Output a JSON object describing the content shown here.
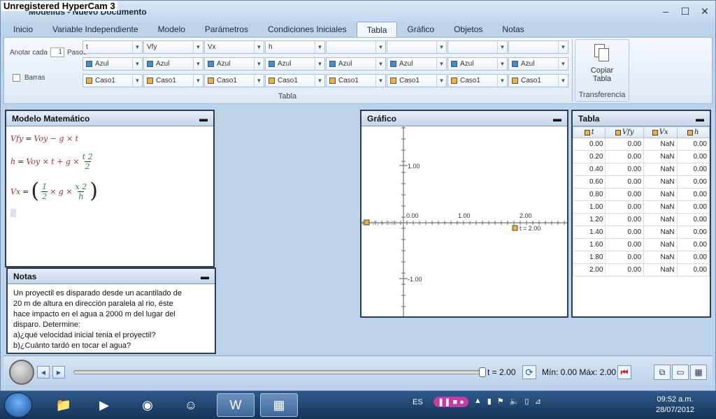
{
  "watermark": "Unregistered HyperCam 3",
  "window": {
    "title": "Modellus - Nuevo Documento"
  },
  "tabs": [
    "Inicio",
    "Variable Independiente",
    "Modelo",
    "Parámetros",
    "Condiciones Iniciales",
    "Tabla",
    "Gráfico",
    "Objetos",
    "Notas"
  ],
  "active_tab": "Tabla",
  "ribbon": {
    "anotar_label": "Anotar cada",
    "anotar_value": "1",
    "pasos_label": "Pasos",
    "barras_label": "Barras",
    "group_label": "Tabla",
    "columns": [
      {
        "var": "t",
        "color_label": "Azul",
        "case_label": "Caso1"
      },
      {
        "var": "Vfy",
        "color_label": "Azul",
        "case_label": "Caso1"
      },
      {
        "var": "Vx",
        "color_label": "Azul",
        "case_label": "Caso1"
      },
      {
        "var": "h",
        "color_label": "Azul",
        "case_label": "Caso1"
      },
      {
        "var": "",
        "color_label": "Azul",
        "case_label": "Caso1"
      },
      {
        "var": "",
        "color_label": "Azul",
        "case_label": "Caso1"
      },
      {
        "var": "",
        "color_label": "Azul",
        "case_label": "Caso1"
      },
      {
        "var": "",
        "color_label": "Azul",
        "case_label": "Caso1"
      }
    ],
    "copy_label_1": "Copiar",
    "copy_label_2": "Tabla",
    "transfer_label": "Transferencia",
    "blue": "#3a8fd8",
    "orange": "#f0b43a"
  },
  "modelo": {
    "title": "Modelo Matemático",
    "eq1": {
      "lhs": "Vfy",
      "rhs": "Voy − g × t"
    },
    "eq2": {
      "lhs": "h",
      "rhs_a": "Voy × t + g ×",
      "num": "t 2",
      "den": "2"
    },
    "eq3": {
      "lhs": "Vx",
      "num1": "1",
      "den1": "2",
      "mid": "× g ×",
      "num2": "x 2",
      "den2": "h"
    }
  },
  "notas": {
    "title": "Notas",
    "lines": [
      "Un proyectil es disparado desde un acantilado de",
      "20 m de altura en dirección paralela al rio, éste",
      "hace impacto en el agua a 2000 m del lugar del",
      "disparo. Determine:",
      "a)¿qué velocidad inicial tenia el proyectil?",
      "b)¿Cuánto tardó en tocar el agua?"
    ]
  },
  "grafico": {
    "title": "Gráfico",
    "y_ticks": [
      "1.00",
      "-1.00"
    ],
    "x_ticks": [
      "0.00",
      "1.00",
      "2.00"
    ],
    "vfy_label": "Vfy = 0.00",
    "t_label": "t = 2.00"
  },
  "tabla": {
    "title": "Tabla",
    "headers": [
      "t",
      "Vfy",
      "Vx",
      "h"
    ],
    "rows": [
      [
        "0.00",
        "0.00",
        "NaN",
        "0.00"
      ],
      [
        "0.20",
        "0.00",
        "NaN",
        "0.00"
      ],
      [
        "0.40",
        "0.00",
        "NaN",
        "0.00"
      ],
      [
        "0.60",
        "0.00",
        "NaN",
        "0.00"
      ],
      [
        "0.80",
        "0.00",
        "NaN",
        "0.00"
      ],
      [
        "1.00",
        "0.00",
        "NaN",
        "0.00"
      ],
      [
        "1.20",
        "0.00",
        "NaN",
        "0.00"
      ],
      [
        "1.40",
        "0.00",
        "NaN",
        "0.00"
      ],
      [
        "1.60",
        "0.00",
        "NaN",
        "0.00"
      ],
      [
        "1.80",
        "0.00",
        "NaN",
        "0.00"
      ],
      [
        "2.00",
        "0.00",
        "NaN",
        "0.00"
      ]
    ]
  },
  "bottom": {
    "t_value": "t  = 2.00",
    "range_text": "Mín: 0.00  Máx: 2.00",
    "progress": 1.0
  },
  "taskbar": {
    "lang": "ES",
    "time": "09:52 a.m.",
    "date": "28/07/2012"
  }
}
